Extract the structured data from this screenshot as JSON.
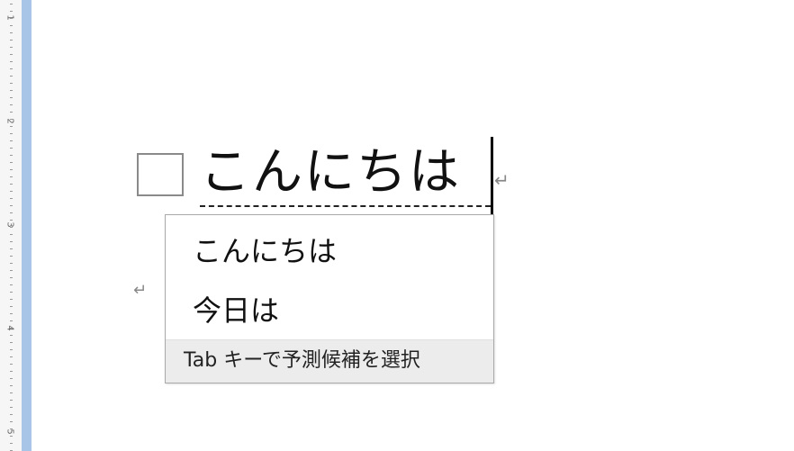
{
  "document": {
    "composed_text": "こんにちは",
    "paragraph_mark": "↵"
  },
  "ruler": {
    "numbers": [
      "1",
      "2",
      "3",
      "4",
      "5"
    ]
  },
  "prediction": {
    "candidates": [
      {
        "label": "こんにちは"
      },
      {
        "label": "今日は"
      }
    ],
    "hint": "Tab キーで予測候補を選択"
  },
  "colors": {
    "ruler_bar": "#a8c4e6",
    "hint_background": "#ececec"
  }
}
